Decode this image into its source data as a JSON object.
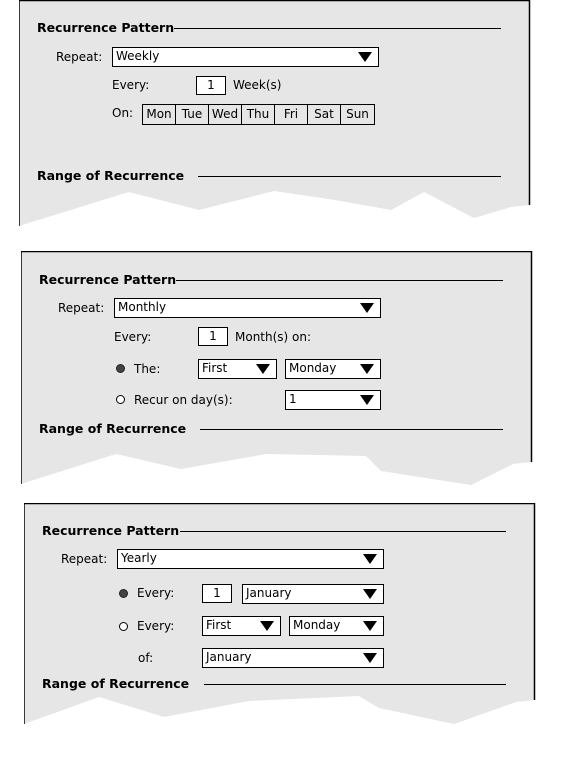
{
  "colors": {
    "panel_bg": "#e6e6e6",
    "border": "#000000",
    "field_bg": "#ffffff"
  },
  "panels": [
    {
      "section_title": "Recurrence Pattern",
      "repeat_label": "Repeat:",
      "repeat_value": "Weekly",
      "every_label": "Every:",
      "every_value": "1",
      "every_unit": "Week(s)",
      "on_label": "On:",
      "days": [
        "Mon",
        "Tue",
        "Wed",
        "Thu",
        "Fri",
        "Sat",
        "Sun"
      ],
      "range_title": "Range of Recurrence"
    },
    {
      "section_title": "Recurrence Pattern",
      "repeat_label": "Repeat:",
      "repeat_value": "Monthly",
      "every_label": "Every:",
      "every_value": "1",
      "every_unit": "Month(s) on:",
      "option_the_label": "The:",
      "option_the_selected": true,
      "the_ordinal": "First",
      "the_weekday": "Monday",
      "option_recur_label": "Recur on day(s):",
      "option_recur_selected": false,
      "recur_day": "1",
      "range_title": "Range of Recurrence"
    },
    {
      "section_title": "Recurrence Pattern",
      "repeat_label": "Repeat:",
      "repeat_value": "Yearly",
      "option_every1_label": "Every:",
      "option_every1_selected": true,
      "every1_day": "1",
      "every1_month": "January",
      "option_every2_label": "Every:",
      "option_every2_selected": false,
      "every2_ordinal": "First",
      "every2_weekday": "Monday",
      "of_label": "of:",
      "of_month": "January",
      "range_title": "Range of Recurrence"
    }
  ]
}
